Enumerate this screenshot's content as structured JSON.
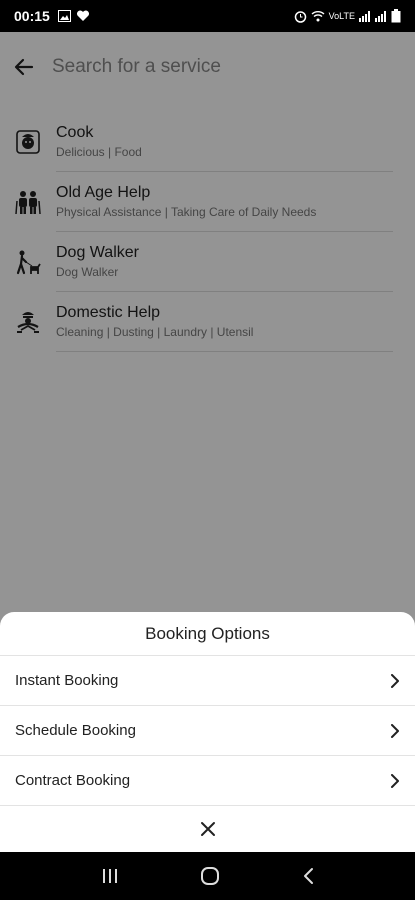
{
  "status_bar": {
    "time": "00:15",
    "indicators": [
      "image-icon",
      "heart-icon",
      "alarm-icon",
      "wifi-icon",
      "volte-signal-icon",
      "volte-signal-icon",
      "battery-icon"
    ],
    "volte_label": "VoLTE"
  },
  "search": {
    "placeholder": "Search for a service"
  },
  "services": [
    {
      "name": "Cook",
      "subtitle": "Delicious | Food",
      "icon": "chef-icon"
    },
    {
      "name": "Old Age Help",
      "subtitle": "Physical Assistance | Taking Care of Daily Needs",
      "icon": "elderly-icon"
    },
    {
      "name": "Dog Walker",
      "subtitle": "Dog Walker",
      "icon": "dog-walker-icon"
    },
    {
      "name": "Domestic Help",
      "subtitle": "Cleaning | Dusting | Laundry | Utensil",
      "icon": "domestic-help-icon"
    }
  ],
  "sheet": {
    "title": "Booking Options",
    "options": [
      {
        "label": "Instant Booking"
      },
      {
        "label": "Schedule Booking"
      },
      {
        "label": "Contract Booking"
      }
    ]
  },
  "colors": {
    "overlay": "#000000",
    "text": "#222222",
    "subtext": "#777777"
  }
}
